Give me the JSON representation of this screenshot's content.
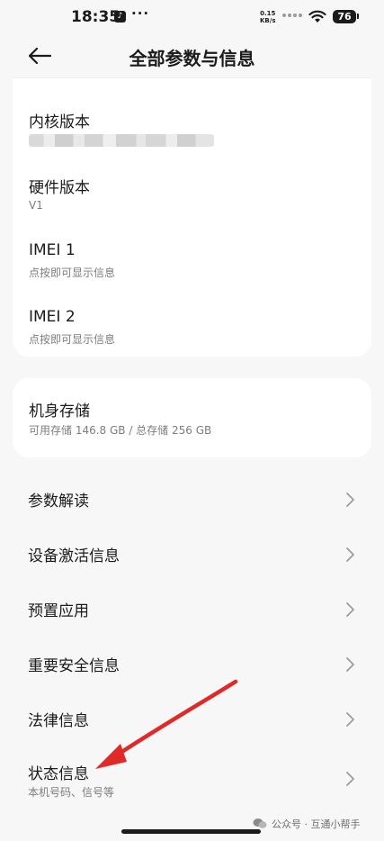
{
  "status_bar": {
    "time": "18:35",
    "net_speed_value": "0.15",
    "net_speed_unit": "KB/s",
    "battery": "76",
    "icons": [
      "tiktok-icon",
      "more-dots-icon",
      "sim-icon",
      "wifi-icon",
      "battery-icon"
    ]
  },
  "header": {
    "title": "全部参数与信息",
    "back_icon": "back-arrow-icon"
  },
  "info_card": {
    "items": [
      {
        "title": "内核版本",
        "subtitle": ""
      },
      {
        "title": "硬件版本",
        "subtitle": "V1"
      },
      {
        "title": "IMEI 1",
        "subtitle": "点按即可显示信息"
      },
      {
        "title": "IMEI 2",
        "subtitle": "点按即可显示信息"
      }
    ]
  },
  "storage_card": {
    "title": "机身存储",
    "subtitle": "可用存储 146.8 GB / 总存储 256 GB"
  },
  "menu": {
    "items": [
      {
        "label": "参数解读",
        "sublabel": ""
      },
      {
        "label": "设备激活信息",
        "sublabel": ""
      },
      {
        "label": "预置应用",
        "sublabel": ""
      },
      {
        "label": "重要安全信息",
        "sublabel": ""
      },
      {
        "label": "法律信息",
        "sublabel": ""
      },
      {
        "label": "状态信息",
        "sublabel": "本机号码、信号等"
      }
    ]
  },
  "watermark": "公众号 · 互通小帮手",
  "colors": {
    "background": "#f7f7f7",
    "card": "#ffffff",
    "text": "#1b1b1b",
    "secondary_text": "#7d7d7d",
    "annotation_arrow": "#e02a2a"
  }
}
